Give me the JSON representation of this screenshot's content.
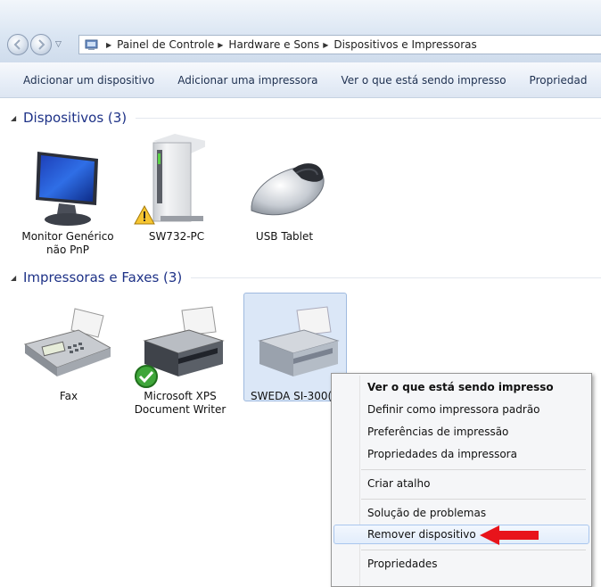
{
  "address_bar": {
    "crumbs": [
      "Painel de Controle",
      "Hardware e Sons",
      "Dispositivos e Impressoras"
    ]
  },
  "command_bar": {
    "items": [
      "Adicionar um dispositivo",
      "Adicionar uma impressora",
      "Ver o que está sendo impresso",
      "Propriedad"
    ]
  },
  "groups": {
    "devices": {
      "title": "Dispositivos (3)",
      "items": [
        {
          "line1": "Monitor Genérico",
          "line2": "não PnP"
        },
        {
          "line1": "SW732-PC"
        },
        {
          "line1": "USB Tablet"
        }
      ]
    },
    "printers": {
      "title": "Impressoras e Faxes (3)",
      "items": [
        {
          "line1": "Fax"
        },
        {
          "line1": "Microsoft XPS",
          "line2": "Document Writer"
        },
        {
          "line1": "SWEDA SI-300("
        }
      ]
    }
  },
  "context_menu": {
    "items": [
      "Ver o que está sendo impresso",
      "Definir como impressora padrão",
      "Preferências de impressão",
      "Propriedades da impressora",
      "Criar atalho",
      "Solução de problemas",
      "Remover dispositivo",
      "Propriedades"
    ],
    "default_item": "Ver o que está sendo impresso",
    "highlighted_item": "Remover dispositivo"
  },
  "colors": {
    "group_title": "#1e3287",
    "selection": "#dbe7f7",
    "annotation_arrow": "#e8141b"
  },
  "icons": [
    "back-icon",
    "forward-icon",
    "control-panel-icon",
    "monitor-icon",
    "computer-tower-icon",
    "warning-icon",
    "mouse-icon",
    "fax-icon",
    "printer-icon",
    "default-checkmark-icon"
  ]
}
